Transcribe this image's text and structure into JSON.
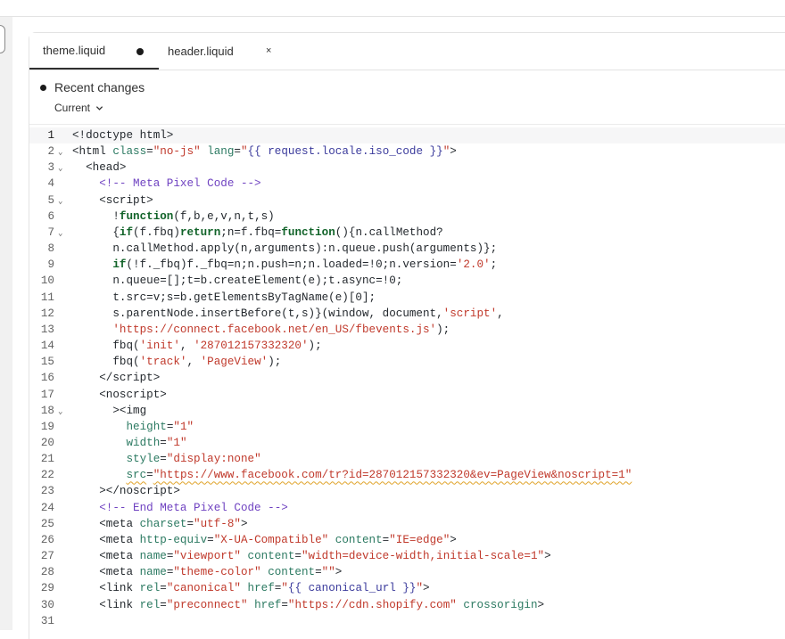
{
  "editor": {
    "tabs": [
      {
        "label": "theme.liquid",
        "state": "modified"
      },
      {
        "label": "header.liquid",
        "state": "closable",
        "close_icon": "×"
      }
    ],
    "recent_changes": {
      "title": "Recent changes",
      "version_selected": "Current"
    },
    "current_line": 1,
    "lines": [
      {
        "n": "1",
        "fold": false,
        "html": "<span class=\"t\">&lt;!doctype html&gt;</span>"
      },
      {
        "n": "2",
        "fold": true,
        "html": "&lt;html <span class=\"a\">class</span>=<span class=\"s\">\"no-js\"</span> <span class=\"a\">lang</span>=<span class=\"s\">\"</span><span class=\"v\">{{ request.locale.iso_code }}</span><span class=\"s\">\"</span>&gt;"
      },
      {
        "n": "3",
        "fold": true,
        "html": "  &lt;head&gt;"
      },
      {
        "n": "4",
        "fold": false,
        "html": "    <span class=\"c\">&lt;!-- Meta Pixel Code --&gt;</span>"
      },
      {
        "n": "5",
        "fold": true,
        "html": "    &lt;script&gt;"
      },
      {
        "n": "6",
        "fold": false,
        "html": "      !<span class=\"k\">function</span>(f,b,e,v,n,t,s)"
      },
      {
        "n": "7",
        "fold": true,
        "html": "      {<span class=\"k\">if</span>(f.fbq)<span class=\"k\">return</span>;n=f.fbq=<span class=\"k\">function</span>(){n.callMethod?"
      },
      {
        "n": "8",
        "fold": false,
        "html": "      n.callMethod.apply(n,arguments):n.queue.push(arguments)};"
      },
      {
        "n": "9",
        "fold": false,
        "html": "      <span class=\"k\">if</span>(!f._fbq)f._fbq=n;n.push=n;n.loaded=!0;n.version=<span class=\"s\">'2.0'</span>;"
      },
      {
        "n": "10",
        "fold": false,
        "html": "      n.queue=[];t=b.createElement(e);t.async=!0;"
      },
      {
        "n": "11",
        "fold": false,
        "html": "      t.src=v;s=b.getElementsByTagName(e)[0];"
      },
      {
        "n": "12",
        "fold": false,
        "html": "      s.parentNode.insertBefore(t,s)}(window, document,<span class=\"s\">'script'</span>,"
      },
      {
        "n": "13",
        "fold": false,
        "html": "      <span class=\"s\">'https://connect.facebook.net/en_US/fbevents.js'</span>);"
      },
      {
        "n": "14",
        "fold": false,
        "html": "      fbq(<span class=\"s\">'init'</span>, <span class=\"s\">'287012157332320'</span>);"
      },
      {
        "n": "15",
        "fold": false,
        "html": "      fbq(<span class=\"s\">'track'</span>, <span class=\"s\">'PageView'</span>);"
      },
      {
        "n": "16",
        "fold": false,
        "html": "    &lt;/script&gt;"
      },
      {
        "n": "17",
        "fold": false,
        "html": "    &lt;noscript&gt;"
      },
      {
        "n": "18",
        "fold": true,
        "html": "      &gt;&lt;img"
      },
      {
        "n": "19",
        "fold": false,
        "html": "        <span class=\"a\">height</span>=<span class=\"s\">\"1\"</span>"
      },
      {
        "n": "20",
        "fold": false,
        "html": "        <span class=\"a\">width</span>=<span class=\"s\">\"1\"</span>"
      },
      {
        "n": "21",
        "fold": false,
        "html": "        <span class=\"a\">style</span>=<span class=\"s\">\"display:none\"</span>"
      },
      {
        "n": "22",
        "fold": false,
        "html": "        <span class=\"a squiggle\">src</span>=<span class=\"s squiggle\">\"https://www.facebook.com/tr?id=287012157332320&amp;ev=PageView&amp;noscript=1\"</span>"
      },
      {
        "n": "23",
        "fold": false,
        "html": "    &gt;&lt;/noscript&gt;"
      },
      {
        "n": "24",
        "fold": false,
        "html": "    <span class=\"c\">&lt;!-- End Meta Pixel Code --&gt;</span>"
      },
      {
        "n": "25",
        "fold": false,
        "html": "    &lt;meta <span class=\"a\">charset</span>=<span class=\"s\">\"utf-8\"</span>&gt;"
      },
      {
        "n": "26",
        "fold": false,
        "html": "    &lt;meta <span class=\"a\">http-equiv</span>=<span class=\"s\">\"X-UA-Compatible\"</span> <span class=\"a\">content</span>=<span class=\"s\">\"IE=edge\"</span>&gt;"
      },
      {
        "n": "27",
        "fold": false,
        "html": "    &lt;meta <span class=\"a\">name</span>=<span class=\"s\">\"viewport\"</span> <span class=\"a\">content</span>=<span class=\"s\">\"width=device-width,initial-scale=1\"</span>&gt;"
      },
      {
        "n": "28",
        "fold": false,
        "html": "    &lt;meta <span class=\"a\">name</span>=<span class=\"s\">\"theme-color\"</span> <span class=\"a\">content</span>=<span class=\"s\">\"\"</span>&gt;"
      },
      {
        "n": "29",
        "fold": false,
        "html": "    &lt;link <span class=\"a\">rel</span>=<span class=\"s\">\"canonical\"</span> <span class=\"a\">href</span>=<span class=\"s\">\"</span><span class=\"v\">{{ canonical_url }}</span><span class=\"s\">\"</span>&gt;"
      },
      {
        "n": "30",
        "fold": false,
        "html": "    &lt;link <span class=\"a\">rel</span>=<span class=\"s\">\"preconnect\"</span> <span class=\"a\">href</span>=<span class=\"s\">\"https://cdn.shopify.com\"</span> <span class=\"a\">crossorigin</span>&gt;"
      },
      {
        "n": "31",
        "fold": false,
        "html": ""
      }
    ]
  }
}
